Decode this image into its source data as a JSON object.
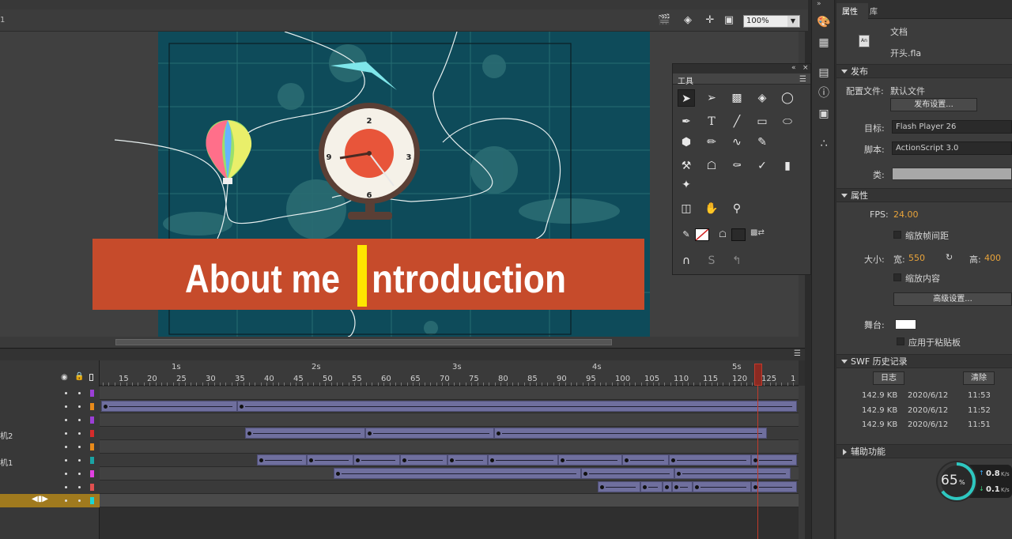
{
  "stage_toolbar": {
    "left_label": "1",
    "zoom": "100%"
  },
  "stage": {
    "banner_text": "About me Introduction",
    "banner_left": "About me",
    "banner_right": "ntroduction",
    "clock_numbers": [
      "2",
      "3",
      "6",
      "9"
    ]
  },
  "tools_panel": {
    "title": "工具",
    "tools": [
      "selection-icon",
      "subselection-icon",
      "free-transform-icon",
      "3d-rotation-icon",
      "lasso-icon",
      "pen-icon",
      "text-icon",
      "line-icon",
      "rectangle-icon",
      "oval-icon",
      "polystar-icon",
      "pencil-icon",
      "paint-brush-icon",
      "brush-icon",
      "bone-icon",
      "paint-bucket-icon",
      "ink-bottle-icon",
      "eyedropper-icon",
      "eraser-icon",
      "width-icon",
      "camera-icon",
      "hand-icon",
      "zoom-icon",
      "stroke-color-icon",
      "fill-color-icon",
      "snap-icon",
      "smooth-icon",
      "straighten-icon"
    ],
    "text_tool": "T"
  },
  "properties": {
    "tab_properties": "属性",
    "tab_library": "库",
    "doc_type": "文档",
    "doc_name": "开头.fla",
    "publish_header": "发布",
    "profile_label": "配置文件:",
    "profile_value": "默认文件",
    "publish_settings_btn": "发布设置...",
    "target_label": "目标:",
    "target_value": "Flash Player 26",
    "script_label": "脚本:",
    "script_value": "ActionScript 3.0",
    "class_label": "类:",
    "props_header": "属性",
    "fps_label": "FPS:",
    "fps_value": "24.00",
    "scale_spans_label": "缩放帧间距",
    "size_label": "大小:",
    "width_label": "宽:",
    "width_value": "550",
    "height_label": "高:",
    "height_value": "400",
    "scale_content_label": "缩放内容",
    "advanced_btn": "高级设置...",
    "stage_label": "舞台:",
    "stage_color": "#ffffff",
    "apply_pasteboard_label": "应用于粘贴板",
    "swf_history_header": "SWF 历史记录",
    "log_btn": "日志",
    "clear_btn": "清除",
    "history": [
      {
        "size": "142.9 KB",
        "date": "2020/6/12",
        "time": "11:53"
      },
      {
        "size": "142.9 KB",
        "date": "2020/6/12",
        "time": "11:52"
      },
      {
        "size": "142.9 KB",
        "date": "2020/6/12",
        "time": "11:51"
      }
    ],
    "accessibility_header": "辅助功能"
  },
  "timeline": {
    "seconds": [
      "1s",
      "2s",
      "3s",
      "4s",
      "5s"
    ],
    "frames": [
      "15",
      "20",
      "25",
      "30",
      "35",
      "40",
      "45",
      "50",
      "55",
      "60",
      "65",
      "70",
      "75",
      "80",
      "85",
      "90",
      "95",
      "100",
      "105",
      "110",
      "115",
      "120",
      "125",
      "1"
    ],
    "layers": [
      {
        "name": "",
        "color": "#9b3fd6"
      },
      {
        "name": "",
        "color": "#e88a1a"
      },
      {
        "name": "",
        "color": "#9b3fd6"
      },
      {
        "name": "机2",
        "color": "#d62b2b"
      },
      {
        "name": "",
        "color": "#e88a1a"
      },
      {
        "name": "机1",
        "color": "#1aa3a3"
      },
      {
        "name": "",
        "color": "#e040e0"
      },
      {
        "name": "",
        "color": "#e05050"
      },
      {
        "name": "",
        "color": "#1ad6d6"
      }
    ]
  },
  "speed_widget": {
    "percent": "65",
    "percent_unit": "%",
    "up": "0.8",
    "up_unit": "K/s",
    "down": "0.1",
    "down_unit": "K/s"
  },
  "colors": {
    "stage_bg": "#0e4b5a",
    "banner": "#c64b2b",
    "cursor_bar": "#ffe600",
    "accent_orange": "#e8a33a",
    "playhead": "#c23a2b",
    "tween": "#6f6f9e"
  }
}
